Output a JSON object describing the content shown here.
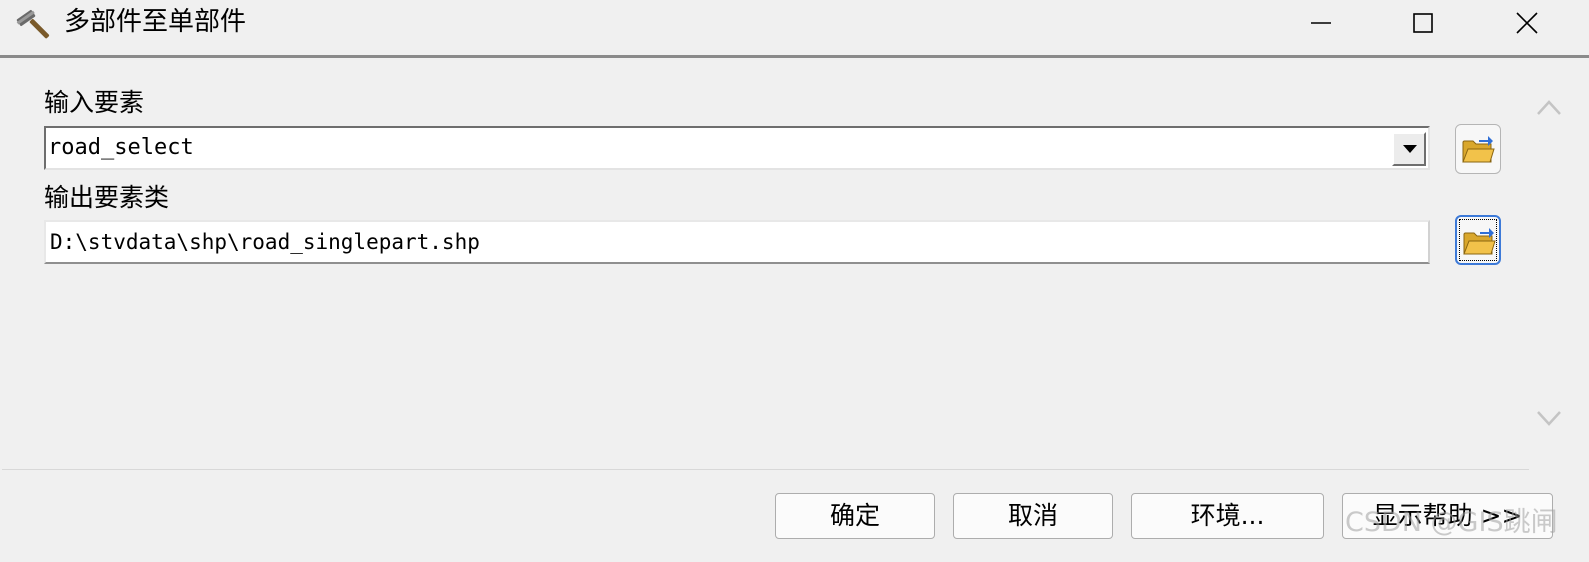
{
  "window": {
    "title": "多部件至单部件",
    "icon": "hammer-icon"
  },
  "titlebar_buttons": {
    "minimize": "minimize-icon",
    "maximize": "maximize-icon",
    "close": "close-icon"
  },
  "form": {
    "input_label": "输入要素",
    "input_value": "road_select",
    "output_label": "输出要素类",
    "output_value": "D:\\stvdata\\shp\\road_singlepart.shp"
  },
  "buttons": {
    "ok": "确定",
    "cancel": "取消",
    "environments": "环境...",
    "show_help": "显示帮助 >>"
  },
  "watermark": "CSDN @GIS跳闸",
  "colors": {
    "background": "#f0f0f0",
    "focus_border": "#3d7ad8",
    "folder_yellow": "#f2c24a"
  }
}
